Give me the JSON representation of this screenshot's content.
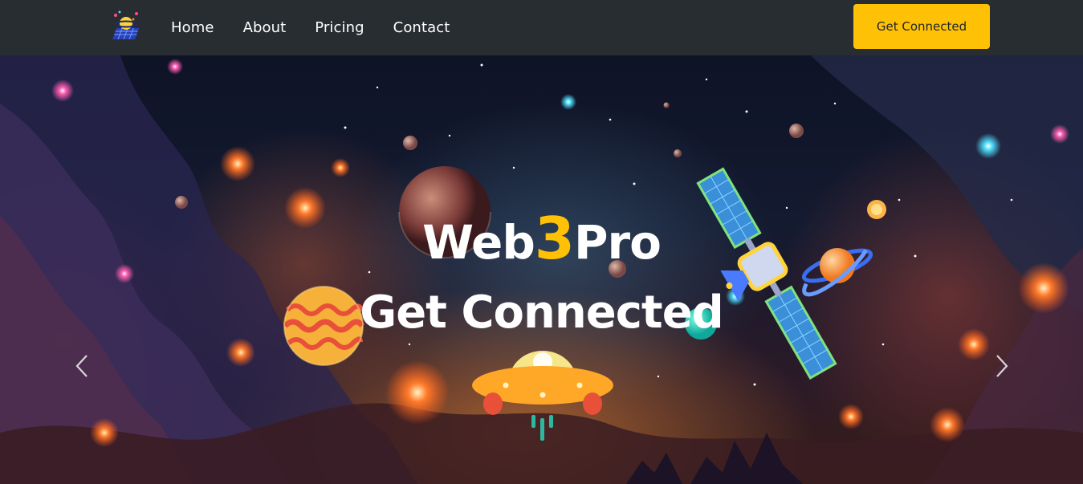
{
  "nav": {
    "links": [
      "Home",
      "About",
      "Pricing",
      "Contact"
    ],
    "cta_label": "Get Connected"
  },
  "hero": {
    "brand_prefix": "Web",
    "brand_accent": "3",
    "brand_suffix": "Pro",
    "subtitle": "Get Connected"
  },
  "colors": {
    "navbar_bg": "#282d31",
    "accent": "#ffc106",
    "text": "#ffffff"
  },
  "icons": {
    "logo": "planet-grid-logo",
    "prev": "chevron-left-icon",
    "next": "chevron-right-icon"
  }
}
